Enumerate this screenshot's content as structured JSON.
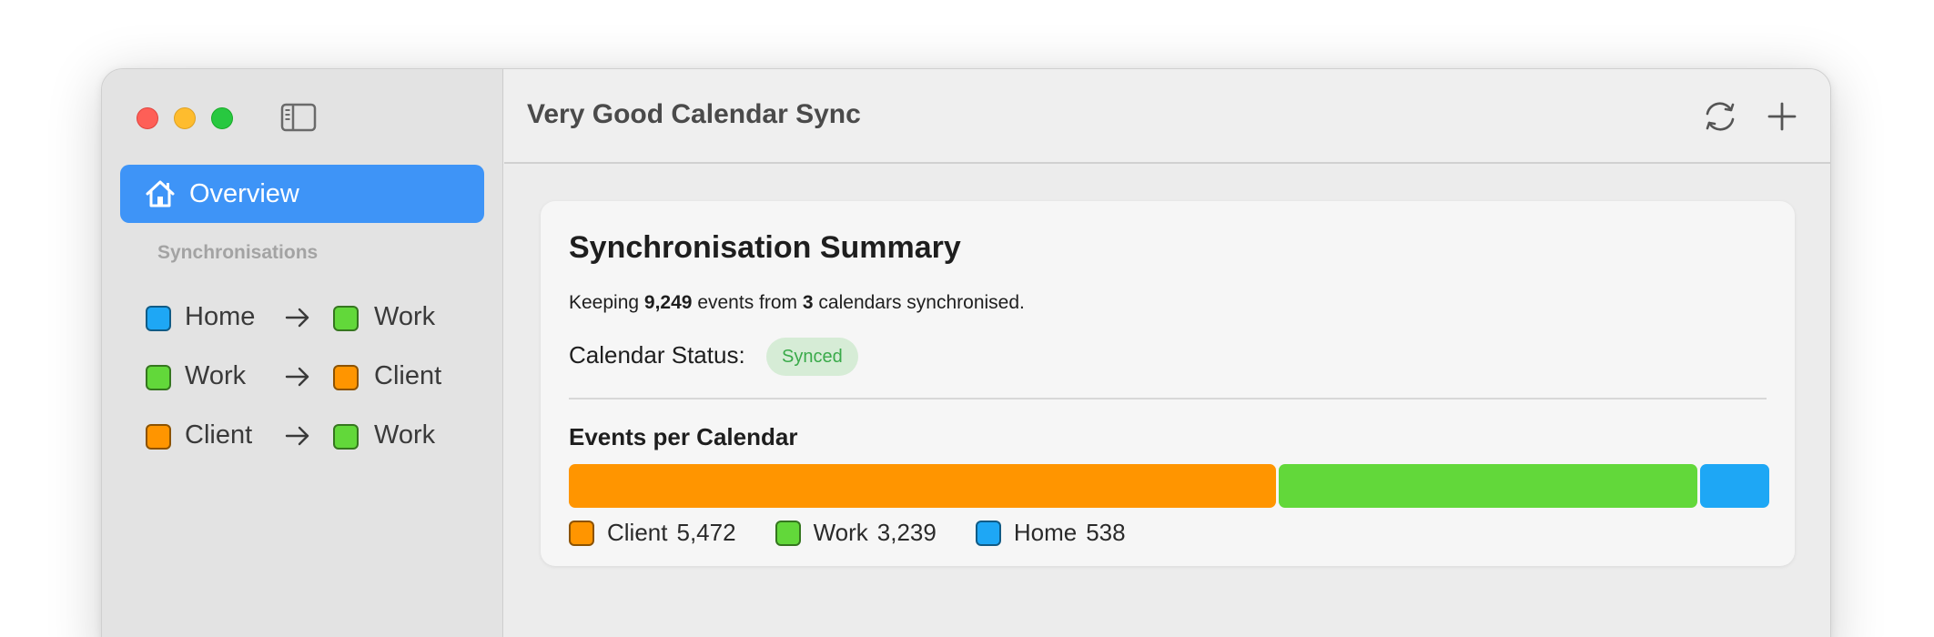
{
  "colors": {
    "client": "#ff9500",
    "work": "#62d83a",
    "home": "#1ea7f5",
    "accent": "#3e94f7"
  },
  "sidebar": {
    "toggle_icon": "sidebar-icon",
    "overview_label": "Overview",
    "section_header": "Synchronisations",
    "syncs": [
      {
        "from": "Home",
        "from_color": "#1ea7f5",
        "to": "Work",
        "to_color": "#62d83a"
      },
      {
        "from": "Work",
        "from_color": "#62d83a",
        "to": "Client",
        "to_color": "#ff9500"
      },
      {
        "from": "Client",
        "from_color": "#ff9500",
        "to": "Work",
        "to_color": "#62d83a"
      }
    ]
  },
  "toolbar": {
    "title": "Very Good Calendar Sync",
    "refresh_icon": "refresh-icon",
    "add_icon": "plus-icon"
  },
  "summary": {
    "title": "Synchronisation Summary",
    "text_prefix": "Keeping",
    "event_count": "9,249",
    "text_middle": "events from",
    "calendar_count": "3",
    "text_suffix": "calendars synchronised.",
    "status_label": "Calendar Status:",
    "status_value": "Synced",
    "events_title": "Events per Calendar"
  },
  "chart_data": {
    "type": "bar",
    "categories": [
      "Client",
      "Work",
      "Home"
    ],
    "values": [
      5472,
      3239,
      538
    ],
    "value_labels": [
      "5,472",
      "3,239",
      "538"
    ],
    "colors": [
      "#ff9500",
      "#62d83a",
      "#1ea7f5"
    ],
    "stacked": true,
    "title": "Events per Calendar"
  }
}
